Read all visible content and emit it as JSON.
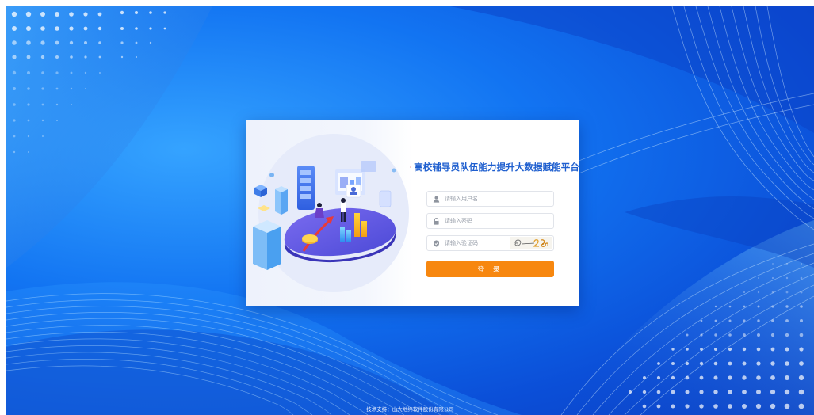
{
  "app": {
    "title": "高校辅导员队伍能力提升大数据赋能平台"
  },
  "form": {
    "username_placeholder": "请输入用户名",
    "username_value": "",
    "password_placeholder": "请输入密码",
    "password_value": "",
    "captcha_placeholder": "请输入验证码",
    "captcha_value": "",
    "login_label": "登 录"
  },
  "icons": {
    "username": "user-icon",
    "password": "lock-icon",
    "captcha": "shield-icon",
    "logo": "brand-logo-icon"
  },
  "footer": {
    "text": "技术支持：山大地纬软件股份有限公司"
  },
  "colors": {
    "background": "#1274f2",
    "title": "#1f5fcf",
    "button": "#f7870f",
    "logo": "#d6232a"
  }
}
